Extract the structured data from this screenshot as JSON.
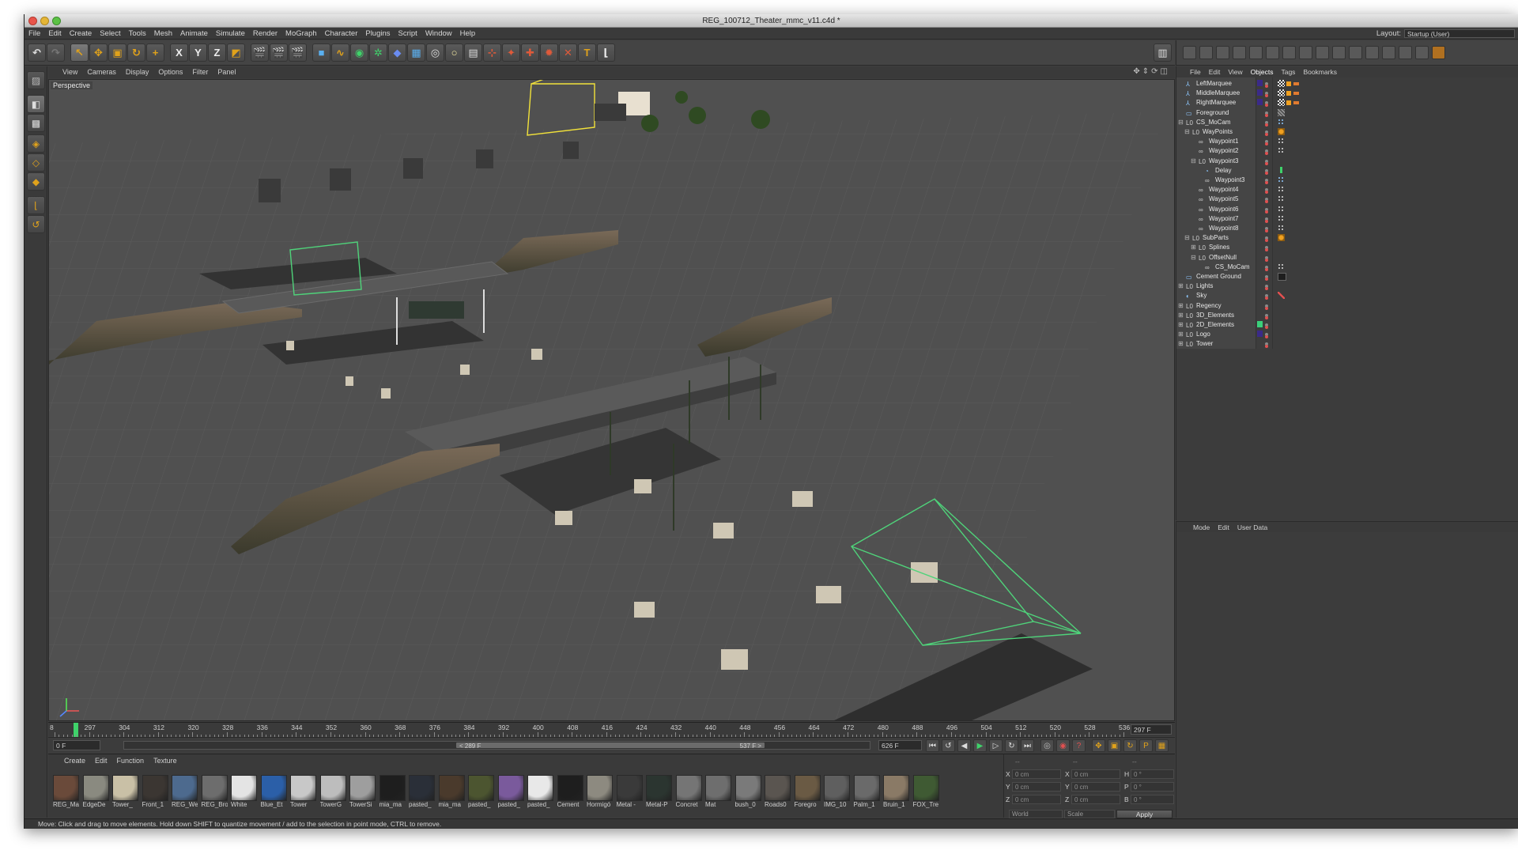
{
  "window": {
    "title": "REG_100712_Theater_mmc_v11.c4d *"
  },
  "menubar": [
    "File",
    "Edit",
    "Create",
    "Select",
    "Tools",
    "Mesh",
    "Animate",
    "Simulate",
    "Render",
    "MoGraph",
    "Character",
    "Plugins",
    "Script",
    "Window",
    "Help"
  ],
  "layout": {
    "label": "Layout:",
    "value": "Startup (User)"
  },
  "viewport": {
    "menu": [
      "View",
      "Cameras",
      "Display",
      "Options",
      "Filter",
      "Panel"
    ],
    "label": "Perspective"
  },
  "timeline": {
    "ticks": [
      "8",
      "297",
      "304",
      "312",
      "320",
      "328",
      "336",
      "344",
      "352",
      "360",
      "368",
      "376",
      "384",
      "392",
      "400",
      "408",
      "416",
      "424",
      "432",
      "440",
      "448",
      "456",
      "464",
      "472",
      "480",
      "488",
      "496",
      "504",
      "512",
      "520",
      "528",
      "536"
    ],
    "current_frame": "297 F"
  },
  "transport": {
    "start_field": "0 F",
    "range_start": "< 289 F",
    "range_end": "537 F >",
    "end_field": "626 F"
  },
  "materials": {
    "menu": [
      "Create",
      "Edit",
      "Function",
      "Texture"
    ],
    "items": [
      {
        "name": "REG_Ma",
        "color": "#6a4a3a"
      },
      {
        "name": "EdgeDe",
        "color": "#8a8a80"
      },
      {
        "name": "Tower_",
        "color": "#c9c0a6"
      },
      {
        "name": "Front_1",
        "color": "#3b3632"
      },
      {
        "name": "REG_We",
        "color": "#4d6a8e"
      },
      {
        "name": "REG_Bro",
        "color": "#6d6d6d"
      },
      {
        "name": "White",
        "color": "#e4e4e4"
      },
      {
        "name": "Blue_Et",
        "color": "#2b5fa8"
      },
      {
        "name": "Tower",
        "color": "#c8c8c8"
      },
      {
        "name": "TowerG",
        "color": "#bdbdbd"
      },
      {
        "name": "TowerSi",
        "color": "#9e9e9e"
      },
      {
        "name": "mia_ma",
        "color": "#1e1e1e"
      },
      {
        "name": "pasted_",
        "color": "#2a2f38"
      },
      {
        "name": "mia_ma",
        "color": "#4a3a2c"
      },
      {
        "name": "pasted_",
        "color": "#4c5530"
      },
      {
        "name": "pasted_",
        "color": "#7a5a9c"
      },
      {
        "name": "pasted_",
        "color": "#e8e8e8"
      },
      {
        "name": "Cement",
        "color": "#1e1e1e"
      },
      {
        "name": "Hormigó",
        "color": "#8d8a80"
      },
      {
        "name": "Metal -",
        "color": "#3a3a3a"
      },
      {
        "name": "Metal-P",
        "color": "#2b3530"
      },
      {
        "name": "Concret",
        "color": "#757575"
      },
      {
        "name": "Mat",
        "color": "#6e6e6e"
      },
      {
        "name": "bush_0",
        "color": "#7a7a7a"
      },
      {
        "name": "Roads0",
        "color": "#5a5550"
      },
      {
        "name": "Foregro",
        "color": "#6a5a44"
      },
      {
        "name": "IMG_10",
        "color": "#5f5f5f"
      },
      {
        "name": "Palm_1",
        "color": "#6a6a6a"
      },
      {
        "name": "Bruin_1",
        "color": "#8a7a66"
      },
      {
        "name": "FOX_Tre",
        "color": "#3f5a33"
      }
    ]
  },
  "coords": {
    "header": [
      "--",
      "--",
      "--"
    ],
    "rows": [
      {
        "axis": "X",
        "pos": "0 cm",
        "axis2": "X",
        "size": "0 cm",
        "axis3": "H",
        "rot": "0 °"
      },
      {
        "axis": "Y",
        "pos": "0 cm",
        "axis2": "Y",
        "size": "0 cm",
        "axis3": "P",
        "rot": "0 °"
      },
      {
        "axis": "Z",
        "pos": "0 cm",
        "axis2": "Z",
        "size": "0 cm",
        "axis3": "B",
        "rot": "0 °"
      }
    ],
    "space_select": "World",
    "mode_select": "Scale",
    "apply_label": "Apply"
  },
  "status": "Move: Click and drag to move elements. Hold down SHIFT to quantize movement / add to the selection in point mode, CTRL to remove.",
  "objects": {
    "menu": [
      "File",
      "Edit",
      "View",
      "Objects",
      "Tags",
      "Bookmarks"
    ],
    "active_menu": "Objects",
    "items": [
      {
        "name": "LeftMarquee",
        "depth": 0,
        "icon": "bone",
        "exp": "",
        "color": "#3a2a88",
        "tags": "checker"
      },
      {
        "name": "MiddleMarquee",
        "depth": 0,
        "icon": "bone",
        "exp": "",
        "color": "#3a2a88",
        "tags": "checker"
      },
      {
        "name": "RightMarquee",
        "depth": 0,
        "icon": "bone",
        "exp": "",
        "color": "#3a2a88",
        "tags": "checker"
      },
      {
        "name": "Foreground",
        "depth": 0,
        "icon": "plane",
        "exp": "",
        "color": "",
        "tags": "hatch"
      },
      {
        "name": "CS_MoCam",
        "depth": 0,
        "icon": "null",
        "exp": "⊟",
        "color": "",
        "tags": "dots"
      },
      {
        "name": "WayPoints",
        "depth": 1,
        "icon": "null",
        "exp": "⊟",
        "color": "",
        "tags": "orange"
      },
      {
        "name": "Waypoint1",
        "depth": 2,
        "icon": "link",
        "exp": "",
        "color": "",
        "tags": "small"
      },
      {
        "name": "Waypoint2",
        "depth": 2,
        "icon": "link",
        "exp": "",
        "color": "",
        "tags": "small"
      },
      {
        "name": "Waypoint3",
        "depth": 2,
        "icon": "null",
        "exp": "⊟",
        "color": "",
        "tags": ""
      },
      {
        "name": "Delay",
        "depth": 3,
        "icon": "delay",
        "exp": "",
        "color": "",
        "tags": "check"
      },
      {
        "name": "Waypoint3",
        "depth": 3,
        "icon": "link",
        "exp": "",
        "color": "",
        "tags": "dots"
      },
      {
        "name": "Waypoint4",
        "depth": 2,
        "icon": "link",
        "exp": "",
        "color": "",
        "tags": "small"
      },
      {
        "name": "Waypoint5",
        "depth": 2,
        "icon": "link",
        "exp": "",
        "color": "",
        "tags": "small"
      },
      {
        "name": "Waypoint6",
        "depth": 2,
        "icon": "link",
        "exp": "",
        "color": "",
        "tags": "small"
      },
      {
        "name": "Waypoint7",
        "depth": 2,
        "icon": "link",
        "exp": "",
        "color": "",
        "tags": "small"
      },
      {
        "name": "Waypoint8",
        "depth": 2,
        "icon": "link",
        "exp": "",
        "color": "",
        "tags": "small"
      },
      {
        "name": "SubParts",
        "depth": 1,
        "icon": "null",
        "exp": "⊟",
        "color": "",
        "tags": "orange"
      },
      {
        "name": "Splines",
        "depth": 2,
        "icon": "null",
        "exp": "⊞",
        "color": "",
        "tags": ""
      },
      {
        "name": "OffsetNull",
        "depth": 2,
        "icon": "null",
        "exp": "⊟",
        "color": "",
        "tags": ""
      },
      {
        "name": "CS_MoCam",
        "depth": 3,
        "icon": "link",
        "exp": "",
        "color": "",
        "tags": "small"
      },
      {
        "name": "Cement Ground",
        "depth": 0,
        "icon": "plane",
        "exp": "",
        "color": "",
        "tags": "dark"
      },
      {
        "name": "Lights",
        "depth": 0,
        "icon": "null",
        "exp": "⊞",
        "color": "",
        "tags": ""
      },
      {
        "name": "Sky",
        "depth": 0,
        "icon": "sky",
        "exp": "",
        "color": "",
        "tags": "redx"
      },
      {
        "name": "Regency",
        "depth": 0,
        "icon": "null",
        "exp": "⊞",
        "color": "",
        "tags": ""
      },
      {
        "name": "3D_Elements",
        "depth": 0,
        "icon": "null",
        "exp": "⊞",
        "color": "",
        "tags": ""
      },
      {
        "name": "2D_Elements",
        "depth": 0,
        "icon": "null",
        "exp": "⊞",
        "color": "#3acf7a",
        "tags": ""
      },
      {
        "name": "Logo",
        "depth": 0,
        "icon": "null",
        "exp": "⊞",
        "color": "#3a2a88",
        "tags": ""
      },
      {
        "name": "Tower",
        "depth": 0,
        "icon": "null",
        "exp": "⊞",
        "color": "",
        "tags": ""
      }
    ]
  },
  "attributes": {
    "menu": [
      "Mode",
      "Edit",
      "User Data"
    ]
  }
}
